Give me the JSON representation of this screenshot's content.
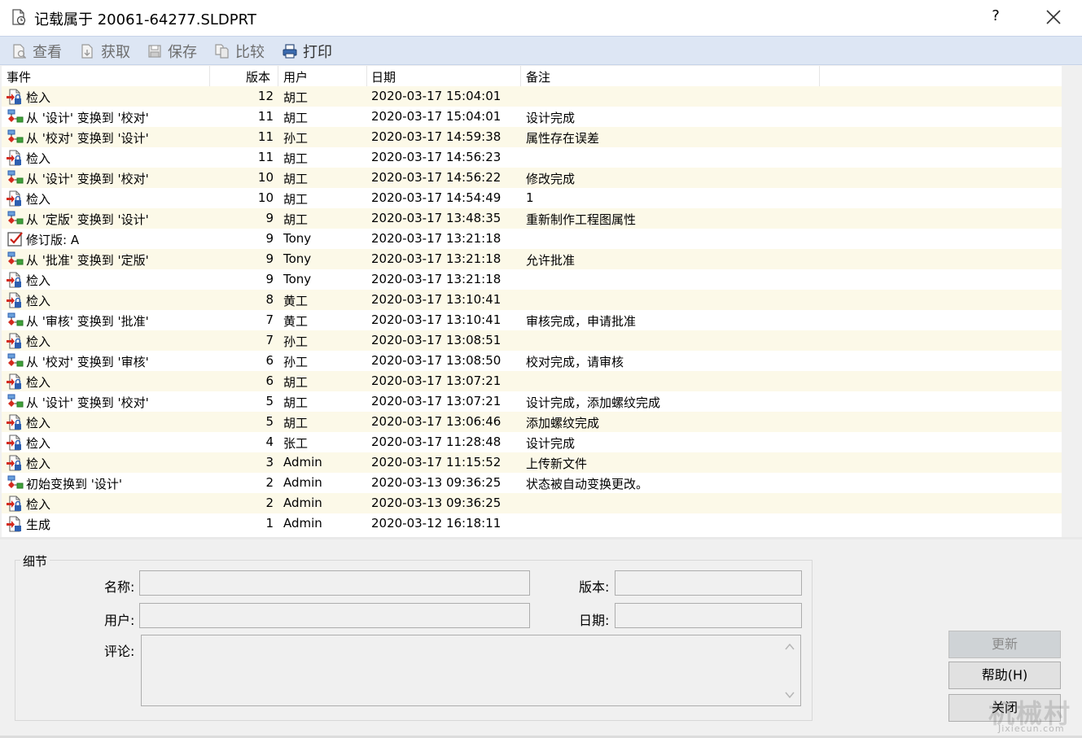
{
  "window": {
    "title": "记载属于 20061-64277.SLDPRT",
    "help": "?"
  },
  "toolbar": {
    "view": "查看",
    "get": "获取",
    "save": "保存",
    "compare": "比较",
    "print": "打印"
  },
  "columns": {
    "event": "事件",
    "version": "版本",
    "user": "用户",
    "date": "日期",
    "note": "备注"
  },
  "rows": [
    {
      "event": "检入",
      "version": "12",
      "user": "胡工",
      "date": "2020-03-17 15:04:01",
      "note": "",
      "icon": "checkin-icon"
    },
    {
      "event": "从 '设计' 变换到 '校对'",
      "version": "11",
      "user": "胡工",
      "date": "2020-03-17 15:04:01",
      "note": "设计完成",
      "icon": "workflow-transition-icon"
    },
    {
      "event": "从 '校对' 变换到 '设计'",
      "version": "11",
      "user": "孙工",
      "date": "2020-03-17 14:59:38",
      "note": "属性存在误差",
      "icon": "workflow-transition-icon"
    },
    {
      "event": "检入",
      "version": "11",
      "user": "胡工",
      "date": "2020-03-17 14:56:23",
      "note": "",
      "icon": "checkin-icon"
    },
    {
      "event": "从 '设计' 变换到 '校对'",
      "version": "10",
      "user": "胡工",
      "date": "2020-03-17 14:56:22",
      "note": "修改完成",
      "icon": "workflow-transition-icon"
    },
    {
      "event": "检入",
      "version": "10",
      "user": "胡工",
      "date": "2020-03-17 14:54:49",
      "note": "1",
      "icon": "checkin-icon"
    },
    {
      "event": "从 '定版' 变换到 '设计'",
      "version": "9",
      "user": "胡工",
      "date": "2020-03-17 13:48:35",
      "note": "重新制作工程图属性",
      "icon": "workflow-transition-icon"
    },
    {
      "event": "修订版: A",
      "version": "9",
      "user": "Tony",
      "date": "2020-03-17 13:21:18",
      "note": "",
      "icon": "revision-check-icon"
    },
    {
      "event": "从 '批准' 变换到 '定版'",
      "version": "9",
      "user": "Tony",
      "date": "2020-03-17 13:21:18",
      "note": "允许批准",
      "icon": "workflow-transition-icon"
    },
    {
      "event": "检入",
      "version": "9",
      "user": "Tony",
      "date": "2020-03-17 13:21:18",
      "note": "",
      "icon": "checkin-icon"
    },
    {
      "event": "检入",
      "version": "8",
      "user": "黄工",
      "date": "2020-03-17 13:10:41",
      "note": "",
      "icon": "checkin-icon"
    },
    {
      "event": "从 '审核' 变换到 '批准'",
      "version": "7",
      "user": "黄工",
      "date": "2020-03-17 13:10:41",
      "note": "审核完成，申请批准",
      "icon": "workflow-transition-icon"
    },
    {
      "event": "检入",
      "version": "7",
      "user": "孙工",
      "date": "2020-03-17 13:08:51",
      "note": "",
      "icon": "checkin-icon"
    },
    {
      "event": "从 '校对' 变换到 '审核'",
      "version": "6",
      "user": "孙工",
      "date": "2020-03-17 13:08:50",
      "note": "校对完成，请审核",
      "icon": "workflow-transition-icon"
    },
    {
      "event": "检入",
      "version": "6",
      "user": "胡工",
      "date": "2020-03-17 13:07:21",
      "note": "",
      "icon": "checkin-icon"
    },
    {
      "event": "从 '设计' 变换到 '校对'",
      "version": "5",
      "user": "胡工",
      "date": "2020-03-17 13:07:21",
      "note": "设计完成，添加螺纹完成",
      "icon": "workflow-transition-icon"
    },
    {
      "event": "检入",
      "version": "5",
      "user": "胡工",
      "date": "2020-03-17 13:06:46",
      "note": "添加螺纹完成",
      "icon": "checkin-icon"
    },
    {
      "event": "检入",
      "version": "4",
      "user": "张工",
      "date": "2020-03-17 11:28:48",
      "note": "设计完成",
      "icon": "checkin-icon"
    },
    {
      "event": "检入",
      "version": "3",
      "user": "Admin",
      "date": "2020-03-17 11:15:52",
      "note": "上传新文件",
      "icon": "checkin-icon"
    },
    {
      "event": "初始变换到 '设计'",
      "version": "2",
      "user": "Admin",
      "date": "2020-03-13 09:36:25",
      "note": "状态被自动变换更改。",
      "icon": "workflow-transition-icon"
    },
    {
      "event": "检入",
      "version": "2",
      "user": "Admin",
      "date": "2020-03-13 09:36:25",
      "note": "",
      "icon": "checkin-icon"
    },
    {
      "event": "生成",
      "version": "1",
      "user": "Admin",
      "date": "2020-03-12 16:18:11",
      "note": "",
      "icon": "create-icon"
    }
  ],
  "details": {
    "legend": "细节",
    "name_label": "名称:",
    "name_value": "",
    "version_label": "版本:",
    "version_value": "",
    "user_label": "用户:",
    "user_value": "",
    "date_label": "日期:",
    "date_value": "",
    "comment_label": "评论:",
    "comment_value": ""
  },
  "buttons": {
    "refresh": "更新",
    "help": "帮助(H)",
    "close": "关闭"
  },
  "watermark": {
    "main": "机械村",
    "sub": "Jixiecun.com"
  }
}
